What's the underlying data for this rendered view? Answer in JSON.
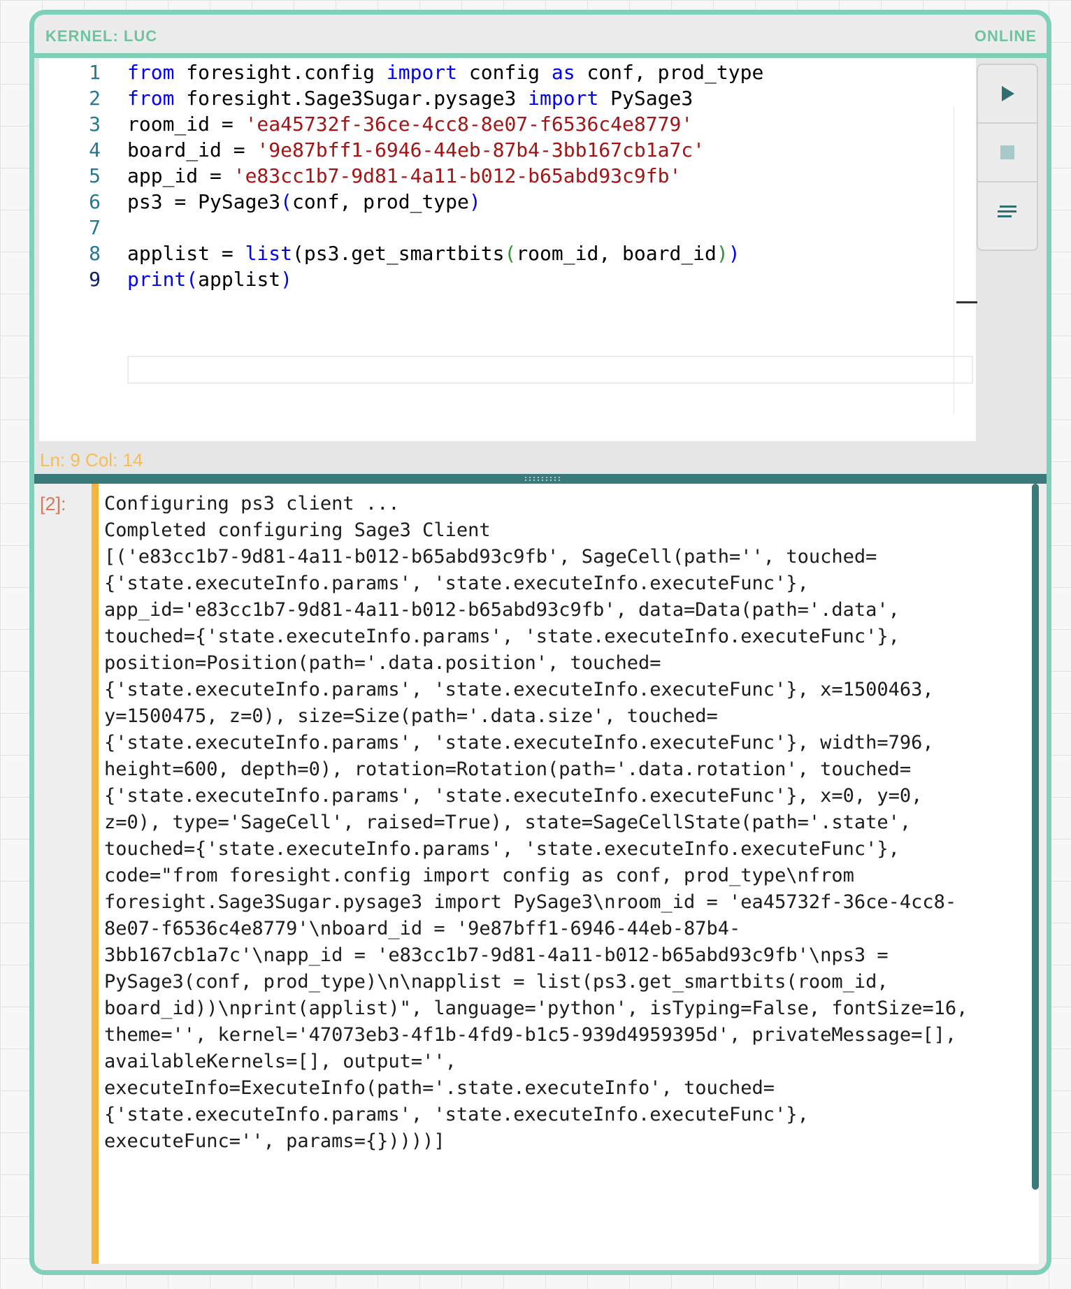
{
  "header": {
    "kernel_label": "KERNEL: LUC",
    "status": "ONLINE"
  },
  "editor": {
    "lines": [
      {
        "number": "1"
      },
      {
        "number": "2"
      },
      {
        "number": "3"
      },
      {
        "number": "4"
      },
      {
        "number": "5"
      },
      {
        "number": "6"
      },
      {
        "number": "7"
      },
      {
        "number": "8"
      },
      {
        "number": "9"
      }
    ],
    "tokens": {
      "l1_from": "from",
      "l1_mod": " foresight.config ",
      "l1_import": "import",
      "l1_cfg": " config ",
      "l1_as": "as",
      "l1_rest": " conf, prod_type",
      "l2_from": "from",
      "l2_mod": " foresight.Sage3Sugar.pysage3 ",
      "l2_import": "import",
      "l2_rest": " PySage3",
      "l3_var": "room_id = ",
      "l3_str": "'ea45732f-36ce-4cc8-8e07-f6536c4e8779'",
      "l4_var": "board_id = ",
      "l4_str": "'9e87bff1-6946-44eb-87b4-3bb167cb1a7c'",
      "l5_var": "app_id = ",
      "l5_str": "'e83cc1b7-9d81-4a11-b012-b65abd93c9fb'",
      "l6_var": "ps3 = PySage3",
      "l6_open": "(",
      "l6_args": "conf, prod_type",
      "l6_close": ")",
      "l8_var": "applist = ",
      "l8_list": "list",
      "l8_open": "(",
      "l8_call": "ps3.get_smartbits",
      "l8_open2": "(",
      "l8_args": "room_id, board_id",
      "l8_close2": ")",
      "l8_close": ")",
      "l9_print": "print",
      "l9_open": "(",
      "l9_arg": "applist",
      "l9_close": ")"
    },
    "cursor_position": "Ln: 9 Col: 14"
  },
  "toolbar": {
    "run_icon": "play-icon",
    "stop_icon": "stop-icon",
    "clear_icon": "clear-output-icon"
  },
  "output": {
    "execution_count": "[2]:",
    "text": "Configuring ps3 client ...\nCompleted configuring Sage3 Client\n[('e83cc1b7-9d81-4a11-b012-b65abd93c9fb', SageCell(path='', touched=\n{'state.executeInfo.params', 'state.executeInfo.executeFunc'},\napp_id='e83cc1b7-9d81-4a11-b012-b65abd93c9fb', data=Data(path='.data',\ntouched={'state.executeInfo.params', 'state.executeInfo.executeFunc'},\nposition=Position(path='.data.position', touched=\n{'state.executeInfo.params', 'state.executeInfo.executeFunc'}, x=1500463,\ny=1500475, z=0), size=Size(path='.data.size', touched=\n{'state.executeInfo.params', 'state.executeInfo.executeFunc'}, width=796,\nheight=600, depth=0), rotation=Rotation(path='.data.rotation', touched=\n{'state.executeInfo.params', 'state.executeInfo.executeFunc'}, x=0, y=0,\nz=0), type='SageCell', raised=True), state=SageCellState(path='.state',\ntouched={'state.executeInfo.params', 'state.executeInfo.executeFunc'},\ncode=\"from foresight.config import config as conf, prod_type\\nfrom\nforesight.Sage3Sugar.pysage3 import PySage3\\nroom_id = 'ea45732f-36ce-4cc8-\n8e07-f6536c4e8779'\\nboard_id = '9e87bff1-6946-44eb-87b4-\n3bb167cb1a7c'\\napp_id = 'e83cc1b7-9d81-4a11-b012-b65abd93c9fb'\\nps3 =\nPySage3(conf, prod_type)\\n\\napplist = list(ps3.get_smartbits(room_id,\nboard_id))\\nprint(applist)\", language='python', isTyping=False, fontSize=16,\ntheme='', kernel='47073eb3-4f1b-4fd9-b1c5-939d4959395d', privateMessage=[],\navailableKernels=[], output='',\nexecuteInfo=ExecuteInfo(path='.state.executeInfo', touched=\n{'state.executeInfo.params', 'state.executeInfo.executeFunc'},\nexecuteFunc='', params={}))))]"
  }
}
